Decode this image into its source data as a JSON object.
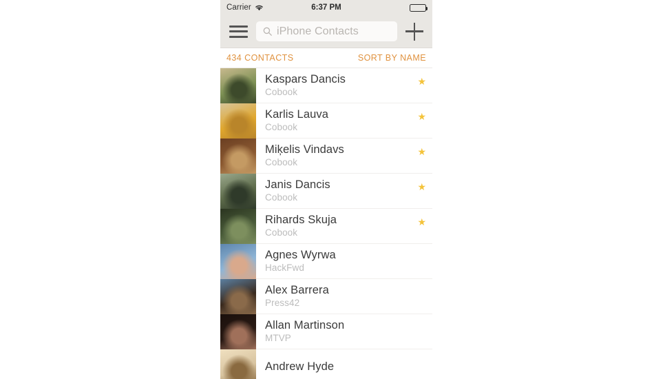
{
  "status_bar": {
    "carrier": "Carrier",
    "wifi_icon": "wifi-icon",
    "time": "6:37 PM",
    "battery_icon": "battery-full-icon"
  },
  "toolbar": {
    "menu_icon": "hamburger-menu-icon",
    "search": {
      "icon": "search-icon",
      "placeholder": "iPhone Contacts",
      "value": ""
    },
    "add_icon": "plus-icon"
  },
  "section_header": {
    "count_label": "434 CONTACTS",
    "sort_label": "SORT BY NAME",
    "accent_color": "#e0923f"
  },
  "contacts": [
    {
      "name": "Kaspars Dancis",
      "org": "Cobook",
      "favorite": true,
      "avatar_colors": [
        "#7d9154",
        "#3d4a2b",
        "#c8b98e"
      ]
    },
    {
      "name": "Karlis Lauva",
      "org": "Cobook",
      "favorite": true,
      "avatar_colors": [
        "#e0a72e",
        "#b9852a",
        "#d8c59a"
      ]
    },
    {
      "name": "Miķelis Vindavs",
      "org": "Cobook",
      "favorite": true,
      "avatar_colors": [
        "#8c5a32",
        "#c49a63",
        "#6b3f22"
      ]
    },
    {
      "name": "Janis Dancis",
      "org": "Cobook",
      "favorite": true,
      "avatar_colors": [
        "#5d6b4a",
        "#2f3a2a",
        "#9aa88c"
      ]
    },
    {
      "name": "Rihards Skuja",
      "org": "Cobook",
      "favorite": true,
      "avatar_colors": [
        "#4a5c3a",
        "#7d8f5e",
        "#2b3520"
      ]
    },
    {
      "name": "Agnes Wyrwa",
      "org": "HackFwd",
      "favorite": false,
      "avatar_colors": [
        "#8fb5d6",
        "#d9a98c",
        "#5e86ad"
      ]
    },
    {
      "name": "Alex Barrera",
      "org": "Press42",
      "favorite": false,
      "avatar_colors": [
        "#3a2a1e",
        "#8a6a4a",
        "#5b7fa0"
      ]
    },
    {
      "name": "Allan Martinson",
      "org": "MTVP",
      "favorite": false,
      "avatar_colors": [
        "#2a1a14",
        "#a0705a",
        "#1a100c"
      ]
    },
    {
      "name": "Andrew Hyde",
      "org": "",
      "favorite": false,
      "avatar_colors": [
        "#d8c4a0",
        "#8a6a40",
        "#f0e0c0"
      ]
    }
  ],
  "favorite_star_icon": "star-icon",
  "favorite_star_color": "#f4c33a"
}
